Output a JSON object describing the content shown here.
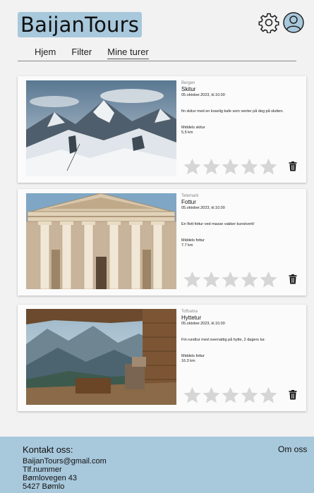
{
  "header": {
    "logo": "BaijanTours",
    "icons": {
      "settings": "gear-icon",
      "profile": "user-icon"
    },
    "nav": [
      {
        "label": "Hjem"
      },
      {
        "label": "Filter"
      },
      {
        "label": "Mine turer",
        "active": true
      }
    ]
  },
  "cards": [
    {
      "location": "Bergen",
      "title": "Skitur",
      "date": "05.oktober.2023, kl.10.00",
      "description": "fin skitur med en koselig kafe som venter på deg på slutten.",
      "level": "Middels skitur",
      "distance": "5,5 km",
      "rating": 0,
      "image": "snowy-mountain-photo"
    },
    {
      "location": "Telemark",
      "title": "Fottur",
      "date": "05.oktober.2023, kl.10.00",
      "description": "En flott fottur ved masse vakker kunstverk!",
      "level": "Middels fottur",
      "distance": "7.7 km",
      "rating": 0,
      "image": "classical-building-photo"
    },
    {
      "location": "Toftsetra",
      "title": "Hyttetur",
      "date": "05.oktober.2023, kl.10.00",
      "description": "Fin rundtur med overnattig på hytte, 2 dagers tur.",
      "level": "Middels fottur",
      "distance": "16.3 km",
      "rating": 0,
      "image": "cabin-valley-photo"
    }
  ],
  "footer": {
    "title": "Kontakt oss:",
    "lines": [
      "BaijanTours@gmail.com",
      "Tlf.nummer",
      "Bømlovegen 43",
      "5427 Bømlo"
    ],
    "about": "Om oss"
  },
  "colors": {
    "accent": "#a8c8dc",
    "background": "#f2f2f2",
    "card": "#fbfbfb",
    "star": "#d6d6d6"
  }
}
